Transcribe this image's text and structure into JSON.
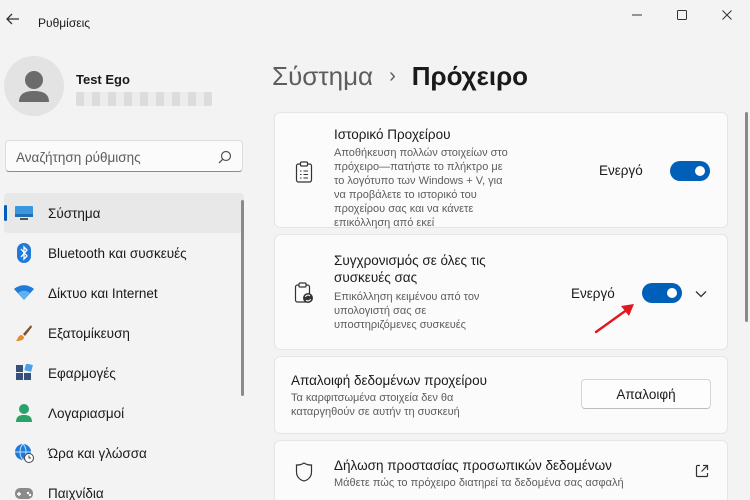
{
  "window": {
    "title": "Ρυθμίσεις"
  },
  "user": {
    "name": "Test Ego"
  },
  "search": {
    "placeholder": "Αναζήτηση ρύθμισης"
  },
  "nav": {
    "items": [
      {
        "label": "Σύστημα",
        "icon": "system-icon",
        "active": true
      },
      {
        "label": "Bluetooth και συσκευές",
        "icon": "bluetooth-icon"
      },
      {
        "label": "Δίκτυο και Internet",
        "icon": "wifi-icon"
      },
      {
        "label": "Εξατομίκευση",
        "icon": "brush-icon"
      },
      {
        "label": "Εφαρμογές",
        "icon": "apps-icon"
      },
      {
        "label": "Λογαριασμοί",
        "icon": "person-icon"
      },
      {
        "label": "Ώρα και γλώσσα",
        "icon": "globe-clock-icon"
      },
      {
        "label": "Παιχνίδια",
        "icon": "gamepad-icon"
      }
    ]
  },
  "breadcrumb": {
    "parent": "Σύστημα",
    "separator": "›",
    "current": "Πρόχειρο"
  },
  "cards": {
    "history": {
      "title": "Ιστορικό Προχείρου",
      "desc": [
        "Αποθήκευση πολλών στοιχείων στο",
        "πρόχειρο—πατήστε το πλήκτρο με",
        "το λογότυπο των Windows + V, για",
        "να προβάλετε το ιστορικό του",
        "προχείρου σας και να κάνετε",
        "επικόλληση από εκεί"
      ],
      "state": "Ενεργό",
      "on": true
    },
    "sync": {
      "title": [
        "Συγχρονισμός σε όλες τις",
        "συσκευές σας"
      ],
      "desc": [
        "Επικόλληση κειμένου από τον",
        "υπολογιστή σας σε",
        "υποστηριζόμενες συσκευές"
      ],
      "state": "Ενεργό",
      "on": true
    },
    "clear": {
      "title": "Απαλοιφή δεδομένων προχείρου",
      "desc": [
        "Τα καρφιτσωμένα στοιχεία δεν θα",
        "καταργηθούν σε αυτήν τη συσκευή"
      ],
      "button": "Απαλοιφή"
    },
    "privacy": {
      "title": "Δήλωση προστασίας προσωπικών δεδομένων",
      "desc": "Μάθετε πώς το πρόχειρο διατηρεί τα δεδομένα σας ασφαλή"
    }
  },
  "colors": {
    "accent": "#005fb8",
    "annotation_arrow": "#e0191f"
  }
}
